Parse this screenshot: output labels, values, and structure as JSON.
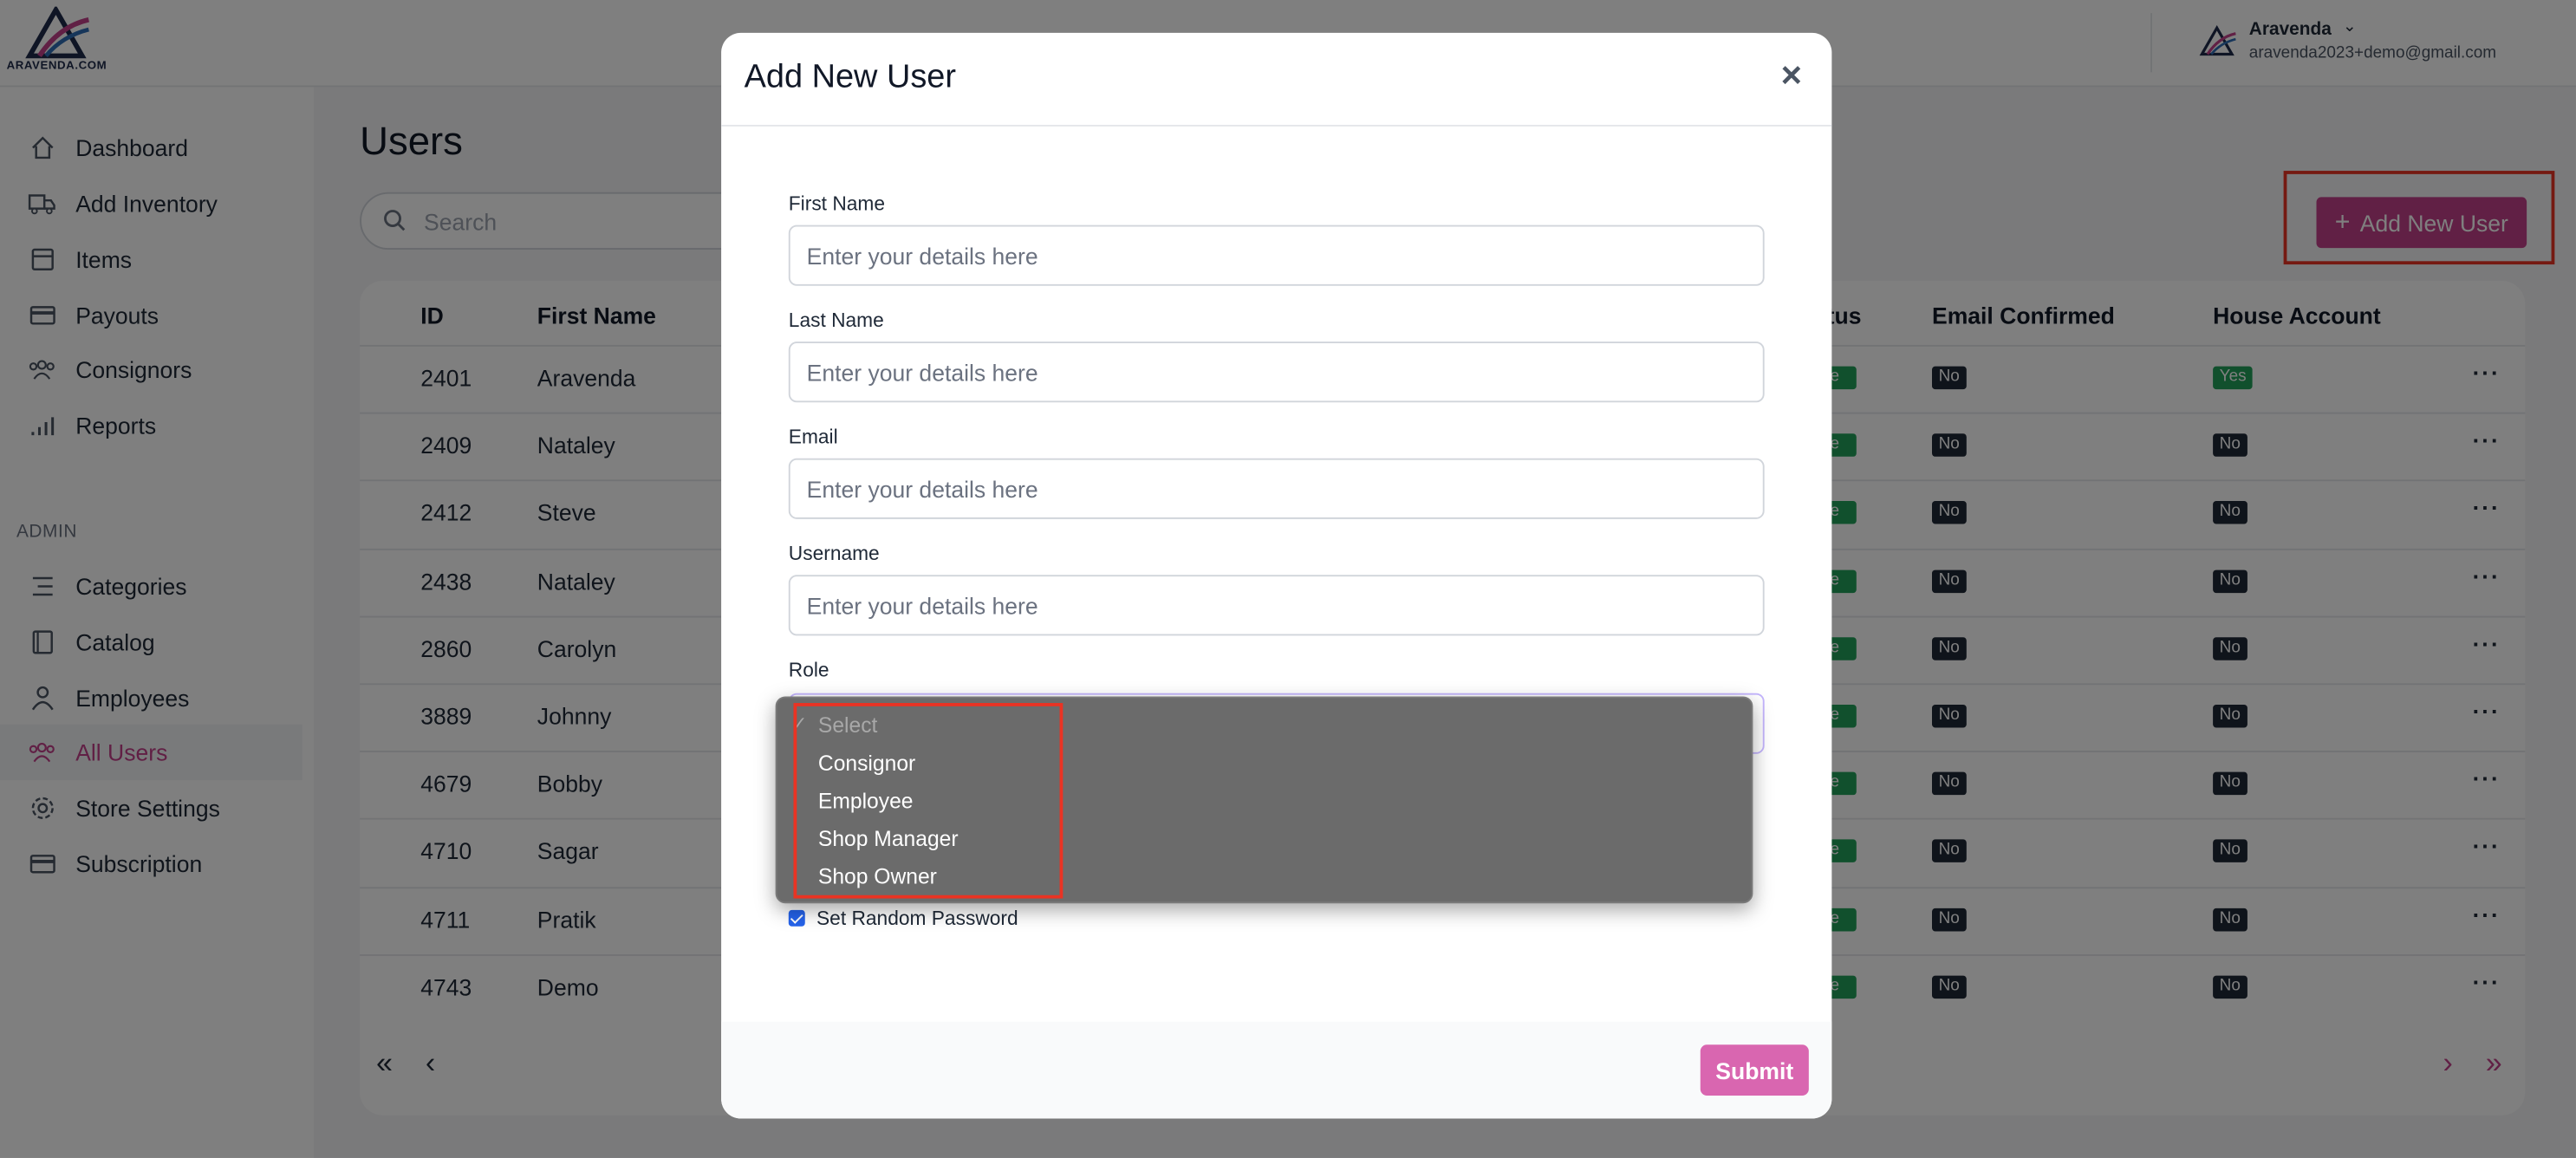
{
  "brand": {
    "name": "ARAVENDA.COM",
    "accent": "#c2418a"
  },
  "user": {
    "name": "Aravenda",
    "email": "aravenda2023+demo@gmail.com"
  },
  "sidebar": {
    "items": [
      {
        "label": "Dashboard",
        "icon": "home-icon"
      },
      {
        "label": "Add Inventory",
        "icon": "truck-icon"
      },
      {
        "label": "Items",
        "icon": "box-icon"
      },
      {
        "label": "Payouts",
        "icon": "credit-card-icon"
      },
      {
        "label": "Consignors",
        "icon": "users-icon"
      },
      {
        "label": "Reports",
        "icon": "bar-chart-icon"
      }
    ],
    "admin_label": "ADMIN",
    "admin_items": [
      {
        "label": "Categories",
        "icon": "list-icon"
      },
      {
        "label": "Catalog",
        "icon": "book-icon"
      },
      {
        "label": "Employees",
        "icon": "person-icon"
      },
      {
        "label": "All Users",
        "icon": "users-icon",
        "active": true
      },
      {
        "label": "Store Settings",
        "icon": "gear-icon"
      },
      {
        "label": "Subscription",
        "icon": "card-icon"
      }
    ]
  },
  "main": {
    "title": "Users",
    "search_placeholder": "Search",
    "add_button": "Add New User",
    "columns": {
      "id": "ID",
      "first_name": "First Name",
      "status": "tus",
      "email_confirmed": "Email Confirmed",
      "house_account": "House Account"
    },
    "status_fragment": "ve",
    "rows": [
      {
        "id": "2401",
        "first_name": "Aravenda",
        "email_confirmed": "No",
        "house_account": "Yes"
      },
      {
        "id": "2409",
        "first_name": "Nataley",
        "email_confirmed": "No",
        "house_account": "No"
      },
      {
        "id": "2412",
        "first_name": "Steve",
        "email_confirmed": "No",
        "house_account": "No"
      },
      {
        "id": "2438",
        "first_name": "Nataley",
        "email_confirmed": "No",
        "house_account": "No"
      },
      {
        "id": "2860",
        "first_name": "Carolyn",
        "email_confirmed": "No",
        "house_account": "No"
      },
      {
        "id": "3889",
        "first_name": "Johnny",
        "email_confirmed": "No",
        "house_account": "No"
      },
      {
        "id": "4679",
        "first_name": "Bobby",
        "email_confirmed": "No",
        "house_account": "No"
      },
      {
        "id": "4710",
        "first_name": "Sagar",
        "email_confirmed": "No",
        "house_account": "No"
      },
      {
        "id": "4711",
        "first_name": "Pratik",
        "email_confirmed": "No",
        "house_account": "No"
      },
      {
        "id": "4743",
        "first_name": "Demo",
        "email_confirmed": "No",
        "house_account": "No"
      }
    ]
  },
  "modal": {
    "title": "Add New User",
    "fields": [
      {
        "label": "First Name",
        "placeholder": "Enter your details here"
      },
      {
        "label": "Last Name",
        "placeholder": "Enter your details here"
      },
      {
        "label": "Email",
        "placeholder": "Enter your details here"
      },
      {
        "label": "Username",
        "placeholder": "Enter your details here"
      }
    ],
    "role_label": "Role",
    "role_options": [
      "Select",
      "Consignor",
      "Employee",
      "Shop Manager",
      "Shop Owner"
    ],
    "role_selected": "Select",
    "random_password_label": "Set Random Password",
    "random_password_checked": true,
    "submit": "Submit"
  }
}
